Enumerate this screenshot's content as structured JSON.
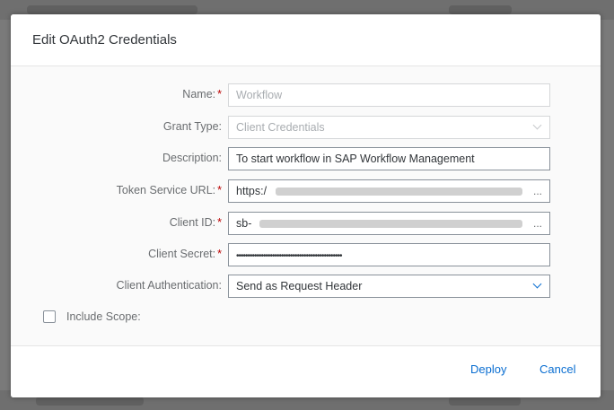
{
  "background": {
    "top_text": "",
    "bottom_text": ""
  },
  "dialog": {
    "title": "Edit OAuth2 Credentials"
  },
  "form": {
    "name": {
      "label": "Name:",
      "value": "Workflow",
      "required": true
    },
    "grant_type": {
      "label": "Grant Type:",
      "value": "Client Credentials",
      "required": false
    },
    "description": {
      "label": "Description:",
      "value": "To start workflow in SAP Workflow Management",
      "required": false
    },
    "token_service_url": {
      "label": "Token Service URL:",
      "value": "https:/",
      "suffix": "...",
      "required": true
    },
    "client_id": {
      "label": "Client ID:",
      "value": "sb-",
      "suffix": "...",
      "required": true
    },
    "client_secret": {
      "label": "Client Secret:",
      "value": "•••••••••••••••••••••••••••••••••••••••••••••••",
      "required": true
    },
    "client_authentication": {
      "label": "Client Authentication:",
      "value": "Send as Request Header",
      "required": false
    },
    "include_scope": {
      "label": "Include Scope:",
      "checked": false
    }
  },
  "footer": {
    "deploy_label": "Deploy",
    "cancel_label": "Cancel"
  },
  "colors": {
    "accent": "#0a6ed1",
    "required": "#bb0000",
    "label": "#6a6d70",
    "text": "#32363a"
  },
  "icons": {
    "dropdown": "chevron-down-icon",
    "checkbox": "checkbox-icon"
  },
  "required_marker": "*"
}
